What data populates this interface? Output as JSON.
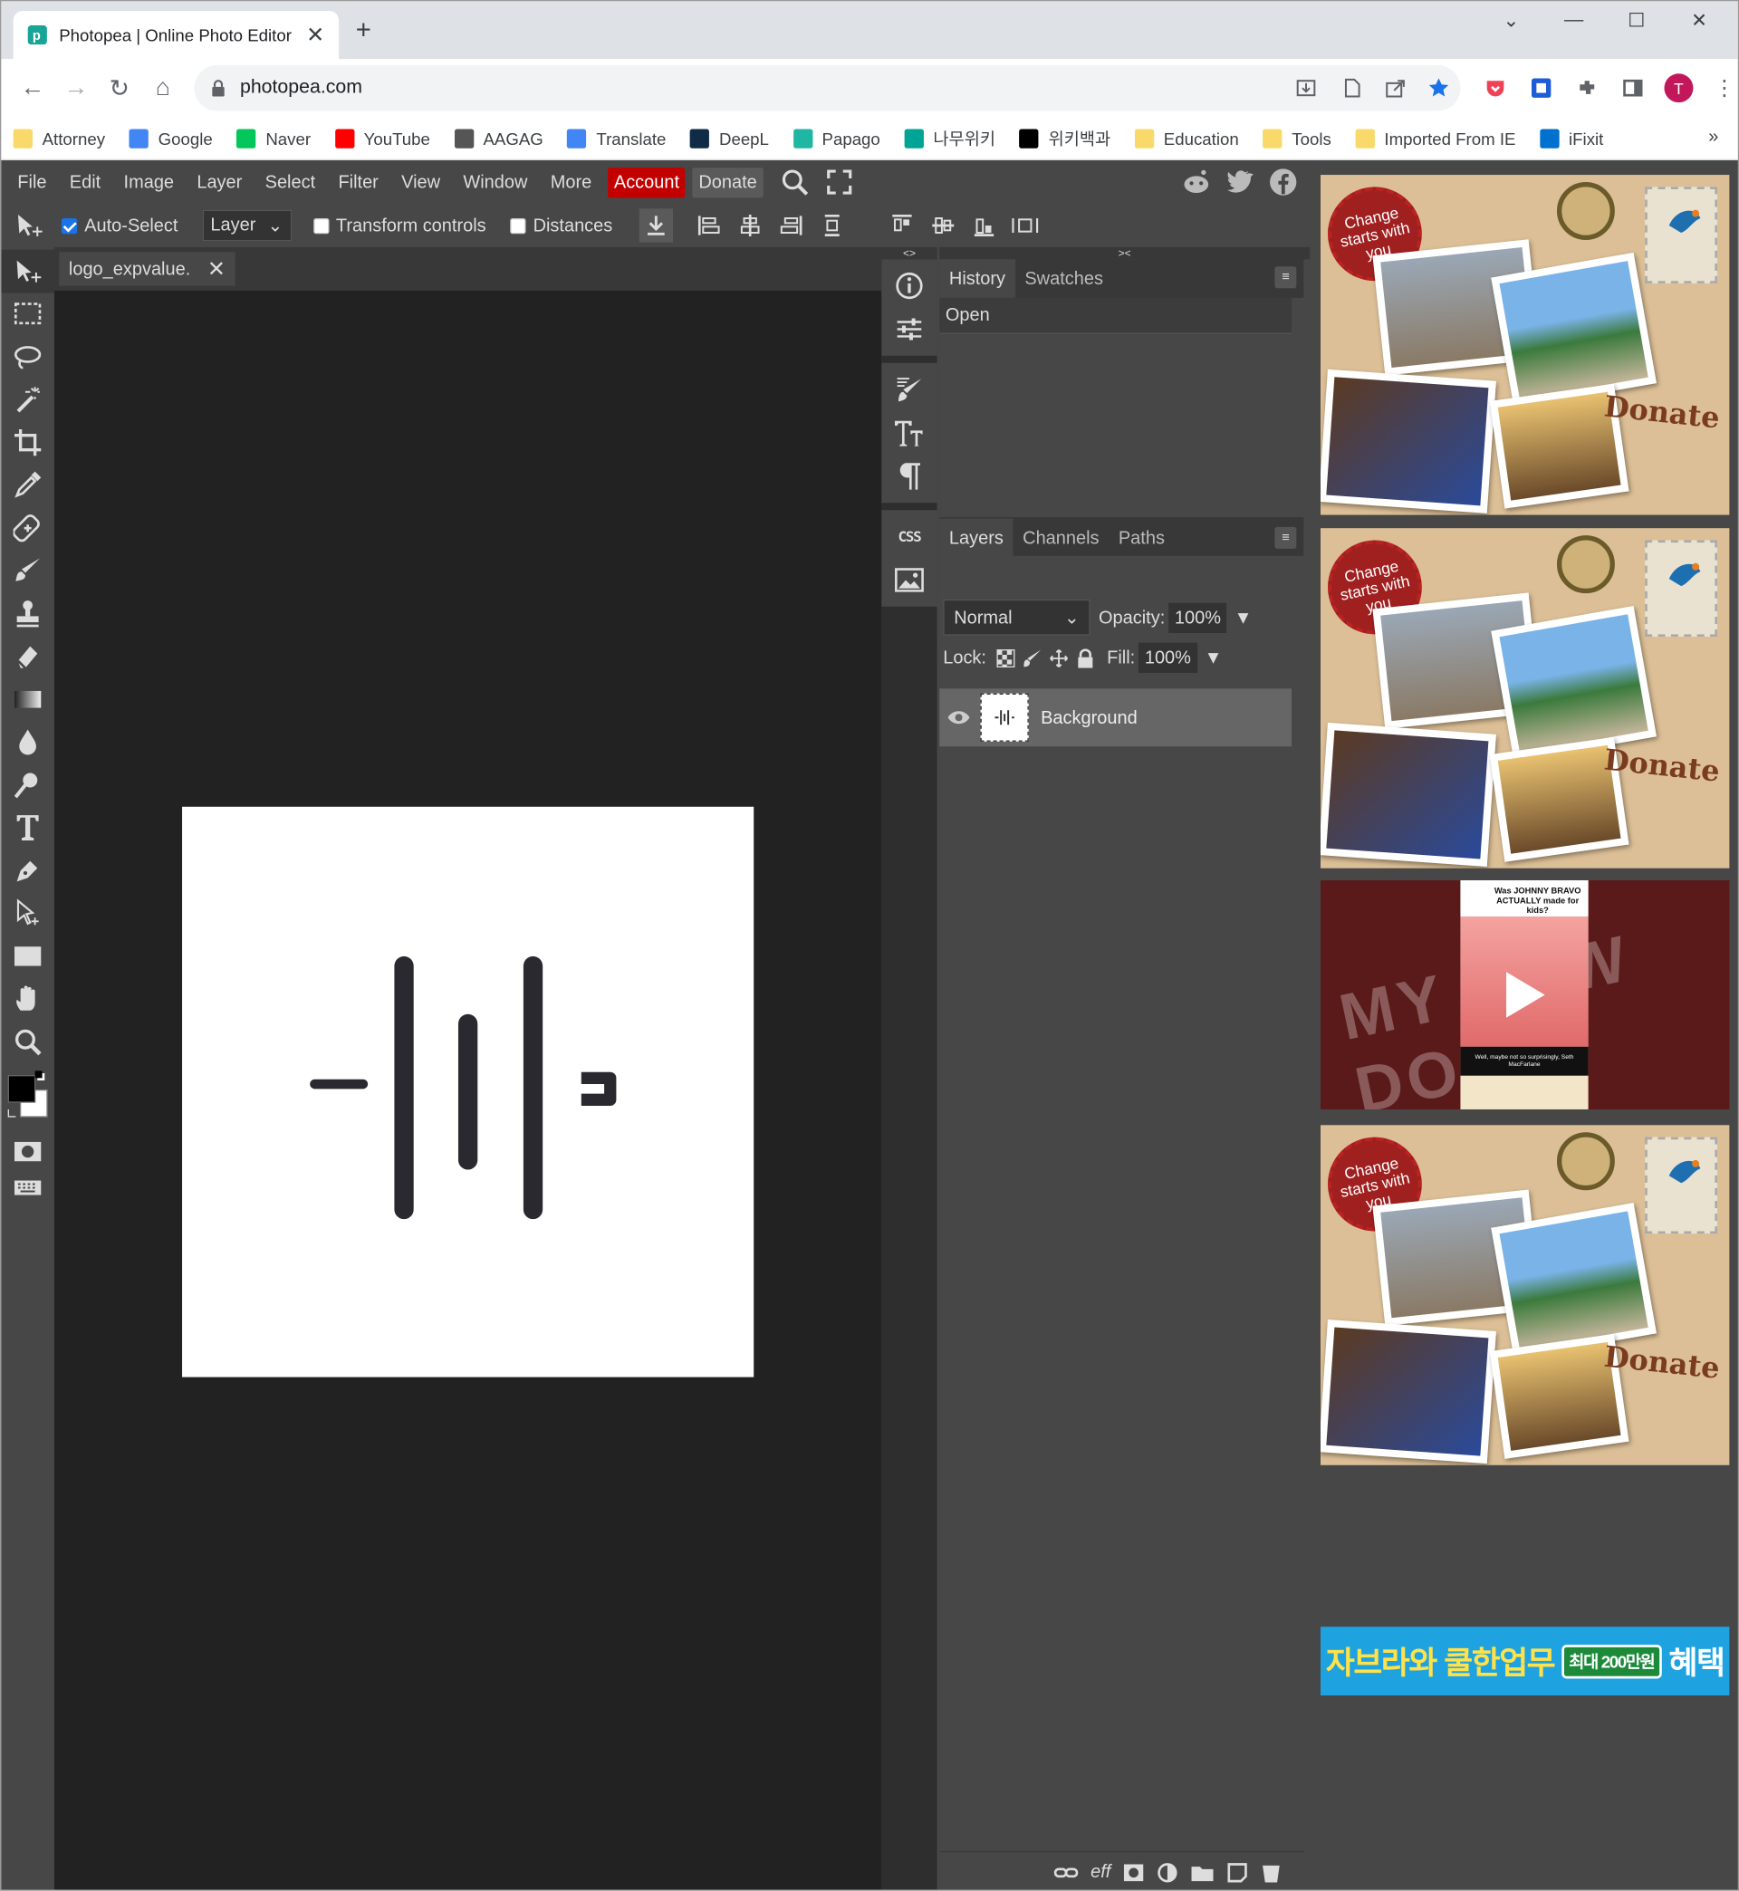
{
  "browser": {
    "tab_title": "Photopea | Online Photo Editor",
    "url": "photopea.com",
    "avatar_letter": "T",
    "bookmarks": [
      {
        "label": "Attorney",
        "icon": "folder-icon",
        "color": "#f9d96a"
      },
      {
        "label": "Google",
        "icon": "google-icon",
        "color": "#4285f4"
      },
      {
        "label": "Naver",
        "icon": "naver-icon",
        "color": "#03c75a"
      },
      {
        "label": "YouTube",
        "icon": "youtube-icon",
        "color": "#ff0000"
      },
      {
        "label": "AAGAG",
        "icon": "aagag-icon",
        "color": "#555555"
      },
      {
        "label": "Translate",
        "icon": "translate-icon",
        "color": "#4285f4"
      },
      {
        "label": "DeepL",
        "icon": "deepl-icon",
        "color": "#0f2b46"
      },
      {
        "label": "Papago",
        "icon": "papago-icon",
        "color": "#1fb7a3"
      },
      {
        "label": "나무위키",
        "icon": "namuwiki-icon",
        "color": "#00a495"
      },
      {
        "label": "위키백과",
        "icon": "wikipedia-icon",
        "color": "#000000"
      },
      {
        "label": "Education",
        "icon": "folder-icon",
        "color": "#f9d96a"
      },
      {
        "label": "Tools",
        "icon": "folder-icon",
        "color": "#f9d96a"
      },
      {
        "label": "Imported From IE",
        "icon": "folder-icon",
        "color": "#f9d96a"
      },
      {
        "label": "iFixit",
        "icon": "ifixit-icon",
        "color": "#0071ce"
      }
    ],
    "bookmarks_more": "»"
  },
  "menu": {
    "items": [
      "File",
      "Edit",
      "Image",
      "Layer",
      "Select",
      "Filter",
      "View",
      "Window",
      "More"
    ],
    "account": "Account",
    "donate": "Donate"
  },
  "options": {
    "auto_select": "Auto-Select",
    "layer_select": "Layer",
    "transform_controls": "Transform controls",
    "distances": "Distances"
  },
  "document": {
    "tab_name": "logo_expvalue."
  },
  "panels": {
    "history_tab": "History",
    "swatches_tab": "Swatches",
    "history_items": [
      "Open"
    ],
    "layers_tab": "Layers",
    "channels_tab": "Channels",
    "paths_tab": "Paths",
    "blend_mode": "Normal",
    "opacity_label": "Opacity:",
    "opacity_value": "100%",
    "lock_label": "Lock:",
    "fill_label": "Fill:",
    "fill_value": "100%",
    "layer_name": "Background",
    "css_label": "CSS",
    "footer_eff": "eff"
  },
  "ads": {
    "postcard_change": "Change starts with you",
    "postcard_donate": "Donate",
    "video_title": "Was JOHNNY BRAVO ACTUALLY made for kids?",
    "video_caption": "Well, maybe not so surprisingly, Seth MacFarlane",
    "video_bg_text": "MY NEW DORK",
    "banner_text": "자브라와 쿨한업무",
    "banner_badge": "최대 200만원",
    "banner_end": "혜택"
  },
  "colors": {
    "account_red": "#c30000",
    "panel_bg": "#474747",
    "canvas_bg": "#222222",
    "accent_blue": "#1a73e8"
  }
}
